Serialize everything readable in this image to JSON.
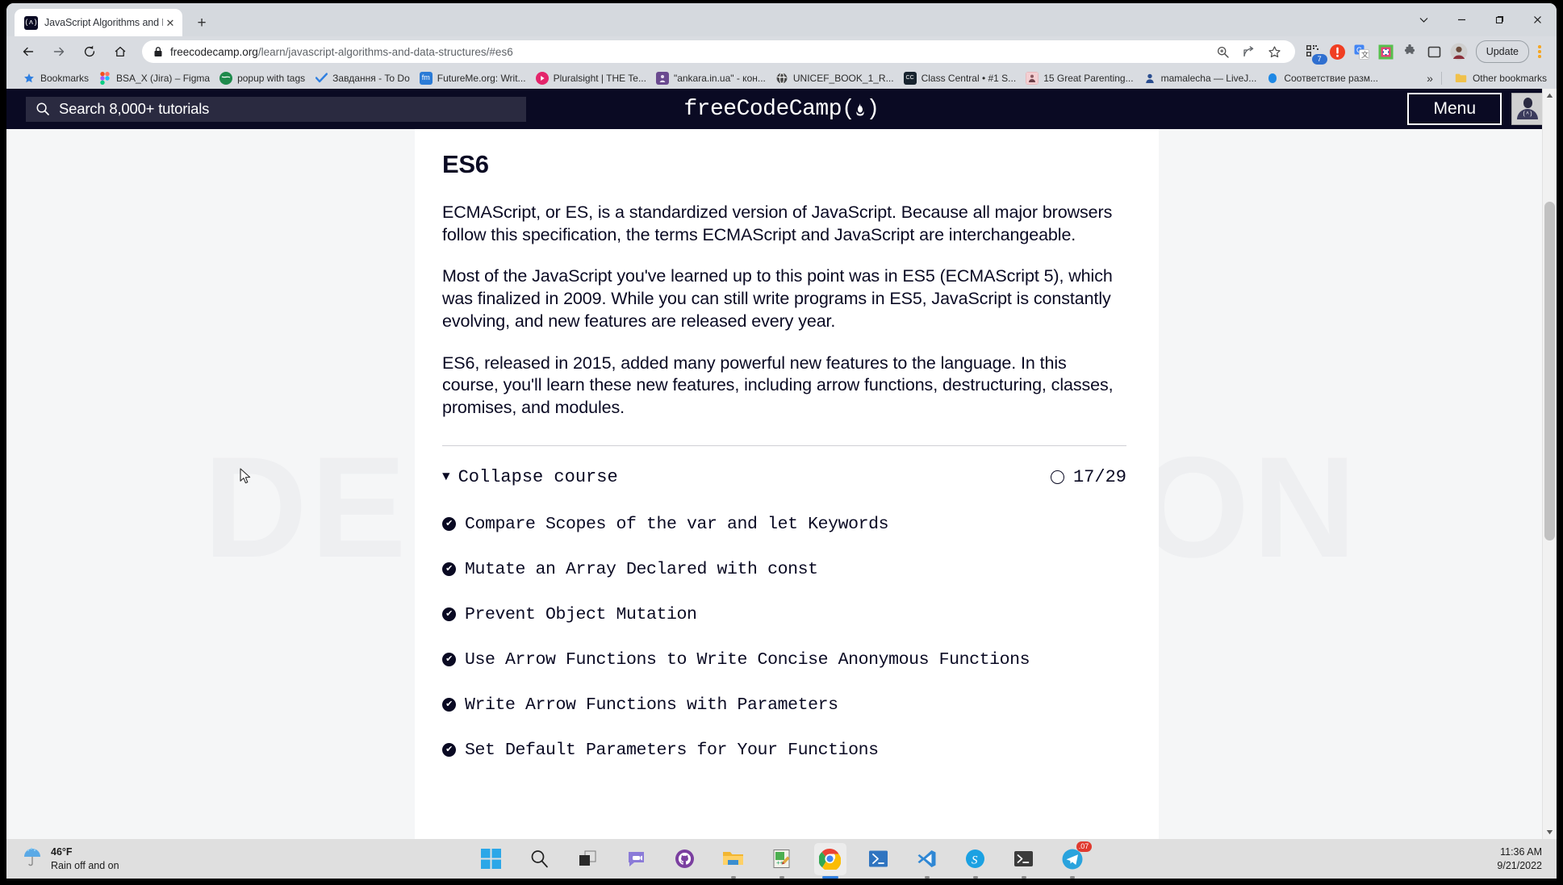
{
  "browser": {
    "tab": {
      "title": "JavaScript Algorithms and Data S",
      "favicon_glyph": "(ʌ)",
      "close_glyph": "✕"
    },
    "new_tab_label": "+",
    "window_controls": {
      "minimize_group": "chevron-down",
      "minimize": "—",
      "maximize": "❐",
      "close": "✕"
    },
    "nav": {
      "back": "←",
      "forward": "→",
      "reload": "⟳",
      "home": "⌂"
    },
    "omnibox": {
      "domain": "freecodecamp.org",
      "path": "/learn/javascript-algorithms-and-data-structures/#es6",
      "lock_icon": "lock-icon"
    },
    "toolbar": {
      "zoom_icon": "zoom-in-icon",
      "share_icon": "share-icon",
      "bookmark_star_icon": "star-icon",
      "qr_badge": "7",
      "update_label": "Update"
    },
    "bookmarks": {
      "items": [
        {
          "label": "Bookmarks",
          "icon": "star-icon",
          "color": "#2f7fe0"
        },
        {
          "label": "BSA_X (Jira) – Figma",
          "icon": "figma-icon",
          "color": "#e64a19"
        },
        {
          "label": "popup with tags",
          "icon": "globe-icon",
          "color": "#1f8a4c"
        },
        {
          "label": "Завдання - To Do",
          "icon": "check-icon",
          "color": "#2f7fe0"
        },
        {
          "label": "FutureMe.org: Writ...",
          "icon": "fm-icon",
          "color": "#2b7bd6"
        },
        {
          "label": "Pluralsight | THE Te...",
          "icon": "pluralsight-icon",
          "color": "#e4256b"
        },
        {
          "label": "\"ankara.in.ua\" - кон...",
          "icon": "person-icon",
          "color": "#6a4a8f"
        },
        {
          "label": "UNICEF_BOOK_1_R...",
          "icon": "globe-dark-icon",
          "color": "#4a4a4a"
        },
        {
          "label": "Class Central • #1 S...",
          "icon": "cc-icon",
          "color": "#17232e"
        },
        {
          "label": "15 Great Parenting...",
          "icon": "photo-icon",
          "color": "#c8737b"
        },
        {
          "label": "mamalecha — LiveJ...",
          "icon": "user-icon",
          "color": "#2a4d8f"
        },
        {
          "label": "Соответствие разм...",
          "icon": "bluetick-icon",
          "color": "#1e88e5"
        }
      ],
      "overflow_glyph": "»",
      "other_bookmarks_label": "Other bookmarks",
      "other_bookmarks_icon": "folder-icon"
    }
  },
  "fcc": {
    "search_placeholder": "Search 8,000+ tutorials",
    "search_icon": "search-icon",
    "logo": "freeCodeCamp(🔥)",
    "logo_text": "freeCodeCamp",
    "menu_label": "Menu",
    "avatar_label": "avatar"
  },
  "page": {
    "watermark": "DEMO VERSION",
    "heading": "ES6",
    "paragraphs": [
      "ECMAScript, or ES, is a standardized version of JavaScript. Because all major browsers follow this specification, the terms ECMAScript and JavaScript are interchangeable.",
      "Most of the JavaScript you've learned up to this point was in ES5 (ECMAScript 5), which was finalized in 2009. While you can still write programs in ES5, JavaScript is constantly evolving, and new features are released every year.",
      "ES6, released in 2015, added many powerful new features to the language. In this course, you'll learn these new features, including arrow functions, destructuring, classes, promises, and modules."
    ],
    "collapse": {
      "caret": "▼",
      "label": "Collapse course",
      "progress": "17/29",
      "progress_completed": 17,
      "progress_total": 29
    },
    "challenges": [
      {
        "label": "Compare Scopes of the var and let Keywords",
        "completed": true
      },
      {
        "label": "Mutate an Array Declared with const",
        "completed": true
      },
      {
        "label": "Prevent Object Mutation",
        "completed": true
      },
      {
        "label": "Use Arrow Functions to Write Concise Anonymous Functions",
        "completed": true
      },
      {
        "label": "Write Arrow Functions with Parameters",
        "completed": true
      },
      {
        "label": "Set Default Parameters for Your Functions",
        "completed": true
      }
    ],
    "check_glyph": "✔"
  },
  "taskbar": {
    "weather": {
      "temperature": "46°F",
      "condition": "Rain off and on",
      "icon": "rain-umbrella-icon"
    },
    "apps": [
      {
        "name": "start-windows-icon",
        "running": false
      },
      {
        "name": "search-icon",
        "running": false
      },
      {
        "name": "task-view-icon",
        "running": false
      },
      {
        "name": "chat-icon",
        "running": false
      },
      {
        "name": "github-desktop-icon",
        "running": false
      },
      {
        "name": "file-explorer-icon",
        "running": true
      },
      {
        "name": "notepadpp-icon",
        "running": true
      },
      {
        "name": "chrome-icon",
        "running": true,
        "active": true
      },
      {
        "name": "powershell-icon",
        "running": false
      },
      {
        "name": "vscode-icon",
        "running": true
      },
      {
        "name": "skype-icon",
        "running": true
      },
      {
        "name": "terminal-icon",
        "running": true
      },
      {
        "name": "telegram-icon",
        "running": true,
        "badge": ".07"
      }
    ],
    "clock": {
      "time": "11:36 AM",
      "date": "9/21/2022"
    }
  }
}
